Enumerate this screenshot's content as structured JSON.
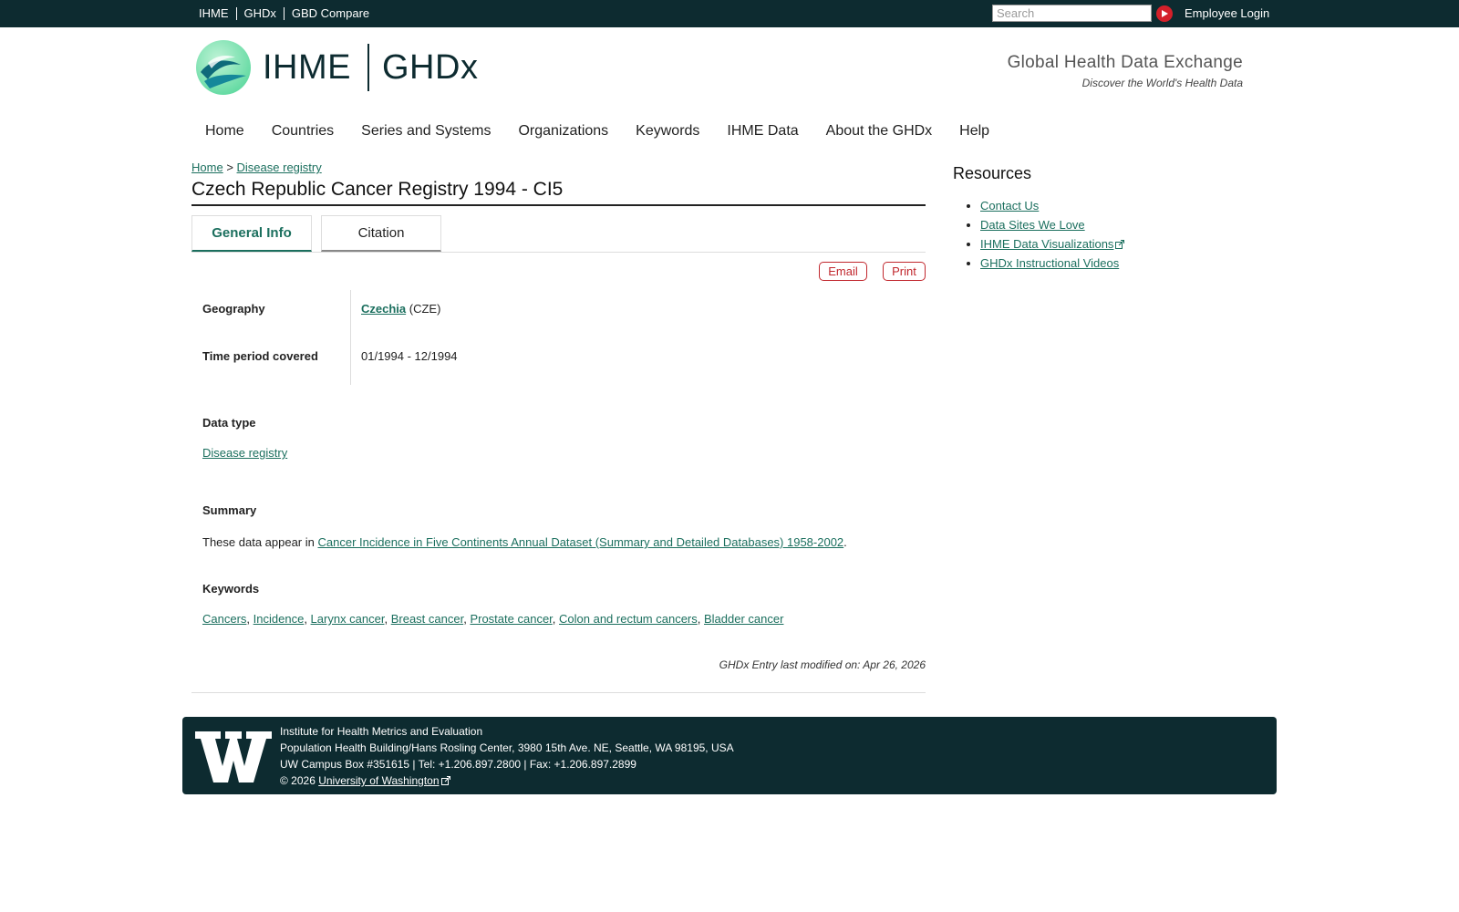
{
  "topbar": {
    "links": [
      "IHME",
      "GHDx",
      "GBD Compare"
    ],
    "search_placeholder": "Search",
    "employee_login": "Employee Login"
  },
  "header": {
    "brand_left": "IHME",
    "brand_right": "GHDx",
    "tagline_title": "Global Health Data Exchange",
    "tagline_sub": "Discover the World's Health Data"
  },
  "nav": {
    "items": [
      "Home",
      "Countries",
      "Series and Systems",
      "Organizations",
      "Keywords",
      "IHME Data",
      "About the GHDx",
      "Help"
    ]
  },
  "breadcrumb": {
    "home": "Home",
    "sep": ">",
    "current": "Disease registry"
  },
  "page": {
    "title": "Czech Republic Cancer Registry 1994 - CI5",
    "tabs": [
      "General Info",
      "Citation"
    ],
    "email_label": "Email",
    "print_label": "Print"
  },
  "info": {
    "geography_label": "Geography",
    "geography_link": "Czechia",
    "geography_code": "(CZE)",
    "time_label": "Time period covered",
    "time_value": "01/1994 - 12/1994"
  },
  "data_type": {
    "heading": "Data type",
    "value": "Disease registry"
  },
  "summary": {
    "heading": "Summary",
    "prefix": "These data appear in",
    "link": "Cancer Incidence in Five Continents Annual Dataset (Summary and Detailed Databases) 1958-2002",
    "suffix": "."
  },
  "keywords": {
    "heading": "Keywords",
    "items": [
      "Cancers",
      "Incidence",
      "Larynx cancer",
      "Breast cancer",
      "Prostate cancer",
      "Colon and rectum cancers",
      "Bladder cancer"
    ]
  },
  "modified": "GHDx Entry last modified on: Apr 26, 2026",
  "sidebar": {
    "title": "Resources",
    "items": [
      "Contact Us",
      "Data Sites We Love",
      "IHME Data Visualizations",
      "GHDx Instructional Videos"
    ]
  },
  "footer": {
    "line1": "Institute for Health Metrics and Evaluation",
    "line2": "Population Health Building/Hans Rosling Center, 3980 15th Ave. NE, Seattle, WA 98195, USA",
    "line3": "UW Campus Box #351615 | Tel: +1.206.897.2800 | Fax: +1.206.897.2899",
    "copyright": "© 2026",
    "uw_link": "University of Washington"
  },
  "colors": {
    "dark_teal": "#0d2b30",
    "link_green": "#1b6f5e",
    "accent_red": "#c1272d"
  }
}
